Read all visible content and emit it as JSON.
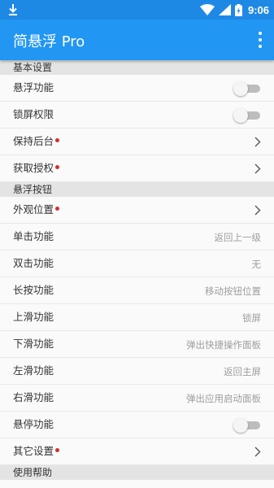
{
  "status_bar": {
    "time": "9:06",
    "icons": [
      "download-icon",
      "wifi-icon",
      "signal-icon",
      "battery-charging-icon"
    ]
  },
  "app_bar": {
    "title": "简悬浮 Pro",
    "overflow_icon": "more-vert-icon"
  },
  "colors": {
    "app_bar": "#2196f3",
    "status_bar": "#1e88e5",
    "dot": "#d32f2f"
  },
  "sections": {
    "basic": {
      "header": "基本设置",
      "float_function": {
        "label": "悬浮功能",
        "enabled": false
      },
      "lock_permission": {
        "label": "锁屏权限",
        "enabled": false
      },
      "keep_background": {
        "label": "保持后台"
      },
      "get_authorization": {
        "label": "获取授权"
      }
    },
    "button": {
      "header": "悬浮按钮",
      "appearance": {
        "label": "外观位置"
      },
      "single_click": {
        "label": "单击功能",
        "value": "返回上一级"
      },
      "double_click": {
        "label": "双击功能",
        "value": "无"
      },
      "long_press": {
        "label": "长按功能",
        "value": "移动按钮位置"
      },
      "swipe_up": {
        "label": "上滑功能",
        "value": "锁屏"
      },
      "swipe_down": {
        "label": "下滑功能",
        "value": "弹出快捷操作面板"
      },
      "swipe_left": {
        "label": "左滑功能",
        "value": "返回主屏"
      },
      "swipe_right": {
        "label": "右滑功能",
        "value": "弹出应用启动面板"
      },
      "hover": {
        "label": "悬停功能",
        "enabled": false
      },
      "other": {
        "label": "其它设置"
      }
    },
    "help": {
      "header": "使用帮助"
    }
  }
}
